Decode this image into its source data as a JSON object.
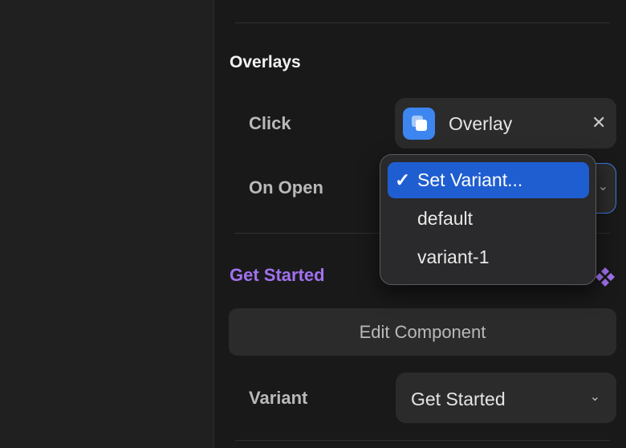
{
  "overlays": {
    "title": "Overlays",
    "click": {
      "label": "Click",
      "value": "Overlay",
      "clear_glyph": "✕"
    },
    "on_open": {
      "label": "On Open"
    }
  },
  "dropdown": {
    "check_glyph": "✓",
    "options": [
      {
        "label": "Set Variant...",
        "selected": true
      },
      {
        "label": "default",
        "selected": false
      },
      {
        "label": "variant-1",
        "selected": false
      }
    ]
  },
  "component": {
    "name": "Get Started",
    "edit_label": "Edit Component",
    "variant_label": "Variant",
    "variant_value": "Get Started"
  },
  "icons": {
    "chevron": "⌄",
    "overlay": "overlay-icon",
    "component": "component-icon"
  },
  "colors": {
    "accent_blue": "#3d86f0",
    "selection_blue": "#1f5ed1",
    "component_purple": "#a072ee"
  }
}
